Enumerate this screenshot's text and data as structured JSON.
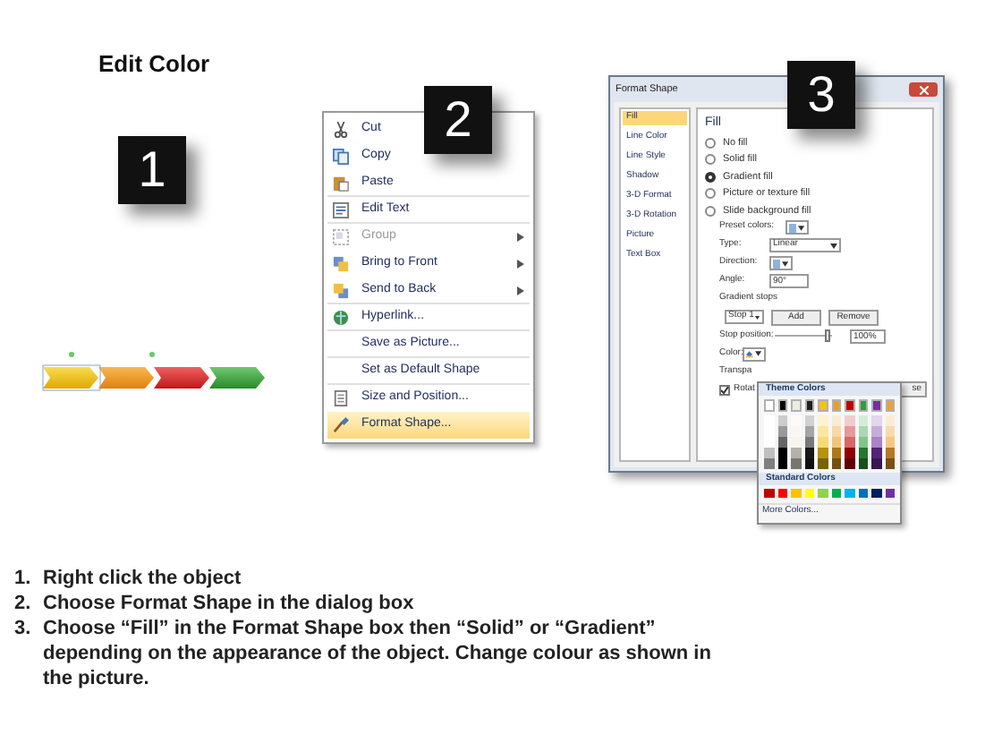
{
  "title": "Edit Color",
  "badges": [
    "1",
    "2",
    "3"
  ],
  "context_menu": {
    "items": [
      {
        "label": "Cut",
        "kind": "scissors",
        "disabled": false,
        "submenu": false,
        "selected": false,
        "separator_after": false
      },
      {
        "label": "Copy",
        "kind": "copy",
        "disabled": false,
        "submenu": false,
        "selected": false,
        "separator_after": false
      },
      {
        "label": "Paste",
        "kind": "paste",
        "disabled": false,
        "submenu": false,
        "selected": false,
        "separator_after": true
      },
      {
        "label": "Edit Text",
        "kind": "text",
        "disabled": false,
        "submenu": false,
        "selected": false,
        "separator_after": true
      },
      {
        "label": "Group",
        "kind": "group",
        "disabled": true,
        "submenu": true,
        "selected": false,
        "separator_after": false
      },
      {
        "label": "Bring to Front",
        "kind": "front",
        "disabled": false,
        "submenu": true,
        "selected": false,
        "separator_after": false
      },
      {
        "label": "Send to Back",
        "kind": "back",
        "disabled": false,
        "submenu": true,
        "selected": false,
        "separator_after": true
      },
      {
        "label": "Hyperlink...",
        "kind": "globe",
        "disabled": false,
        "submenu": false,
        "selected": false,
        "separator_after": true
      },
      {
        "label": "Save as Picture...",
        "kind": "plain",
        "disabled": false,
        "submenu": false,
        "selected": false,
        "separator_after": true
      },
      {
        "label": "Set as Default Shape",
        "kind": "plain",
        "disabled": false,
        "submenu": false,
        "selected": false,
        "separator_after": true
      },
      {
        "label": "Size and Position...",
        "kind": "size",
        "disabled": false,
        "submenu": false,
        "selected": false,
        "separator_after": false
      },
      {
        "label": "Format Shape...",
        "kind": "brush",
        "disabled": false,
        "submenu": false,
        "selected": true,
        "separator_after": false
      }
    ]
  },
  "dialog": {
    "title": "Format Shape",
    "categories": [
      {
        "label": "Fill",
        "selected": true
      },
      {
        "label": "Line Color",
        "selected": false
      },
      {
        "label": "Line Style",
        "selected": false
      },
      {
        "label": "Shadow",
        "selected": false
      },
      {
        "label": "3-D Format",
        "selected": false
      },
      {
        "label": "3-D Rotation",
        "selected": false
      },
      {
        "label": "Picture",
        "selected": false
      },
      {
        "label": "Text Box",
        "selected": false
      }
    ],
    "heading": "Fill",
    "fill_options": [
      {
        "label": "No fill",
        "selected": false
      },
      {
        "label": "Solid fill",
        "selected": false
      },
      {
        "label": "Gradient fill",
        "selected": true
      },
      {
        "label": "Picture or texture fill",
        "selected": false
      },
      {
        "label": "Slide background fill",
        "selected": false
      }
    ],
    "preset_colors_label": "Preset colors:",
    "type_label": "Type:",
    "type_value": "Linear",
    "direction_label": "Direction:",
    "angle_label": "Angle:",
    "angle_value": "90°",
    "gradient_stops_label": "Gradient stops",
    "stop_value": "Stop 1",
    "add_button": "Add",
    "remove_button": "Remove",
    "stop_position_label": "Stop position:",
    "stop_position": {
      "level": 0.92
    },
    "stop_position_value": "100%",
    "color_label": "Color:",
    "transparency_label": "Transpa",
    "rotate_label": "Rotat",
    "rotate_checked": true,
    "close_button": "se"
  },
  "color_dropdown": {
    "theme_heading": "Theme Colors",
    "theme_colors": [
      {
        "color": "#ffffff"
      },
      {
        "color": "#000000"
      },
      {
        "color": "#eeece1"
      },
      {
        "color": "#1f1f1f"
      },
      {
        "color": "#f2c314"
      },
      {
        "color": "#e8a020"
      },
      {
        "color": "#c00000"
      },
      {
        "color": "#2e9e3e"
      },
      {
        "color": "#7030a0"
      },
      {
        "color": "#f0a030"
      }
    ],
    "standard_heading": "Standard Colors",
    "standard_colors": [
      {
        "color": "#c00000"
      },
      {
        "color": "#ff0000"
      },
      {
        "color": "#ffc000"
      },
      {
        "color": "#ffff00"
      },
      {
        "color": "#92d050"
      },
      {
        "color": "#00b050"
      },
      {
        "color": "#00b0f0"
      },
      {
        "color": "#0070c0"
      },
      {
        "color": "#002060"
      },
      {
        "color": "#7030a0"
      }
    ],
    "more_colors": "More Colors..."
  },
  "steps": [
    {
      "number": "1.",
      "text": "Right click the object"
    },
    {
      "number": "2.",
      "text": "Choose Format Shape in the dialog box"
    },
    {
      "number": "3.",
      "text": "Choose “Fill” in the Format Shape box then “Solid” or “Gradient” depending on the appearance of the object. Change colour as shown in the picture."
    }
  ]
}
